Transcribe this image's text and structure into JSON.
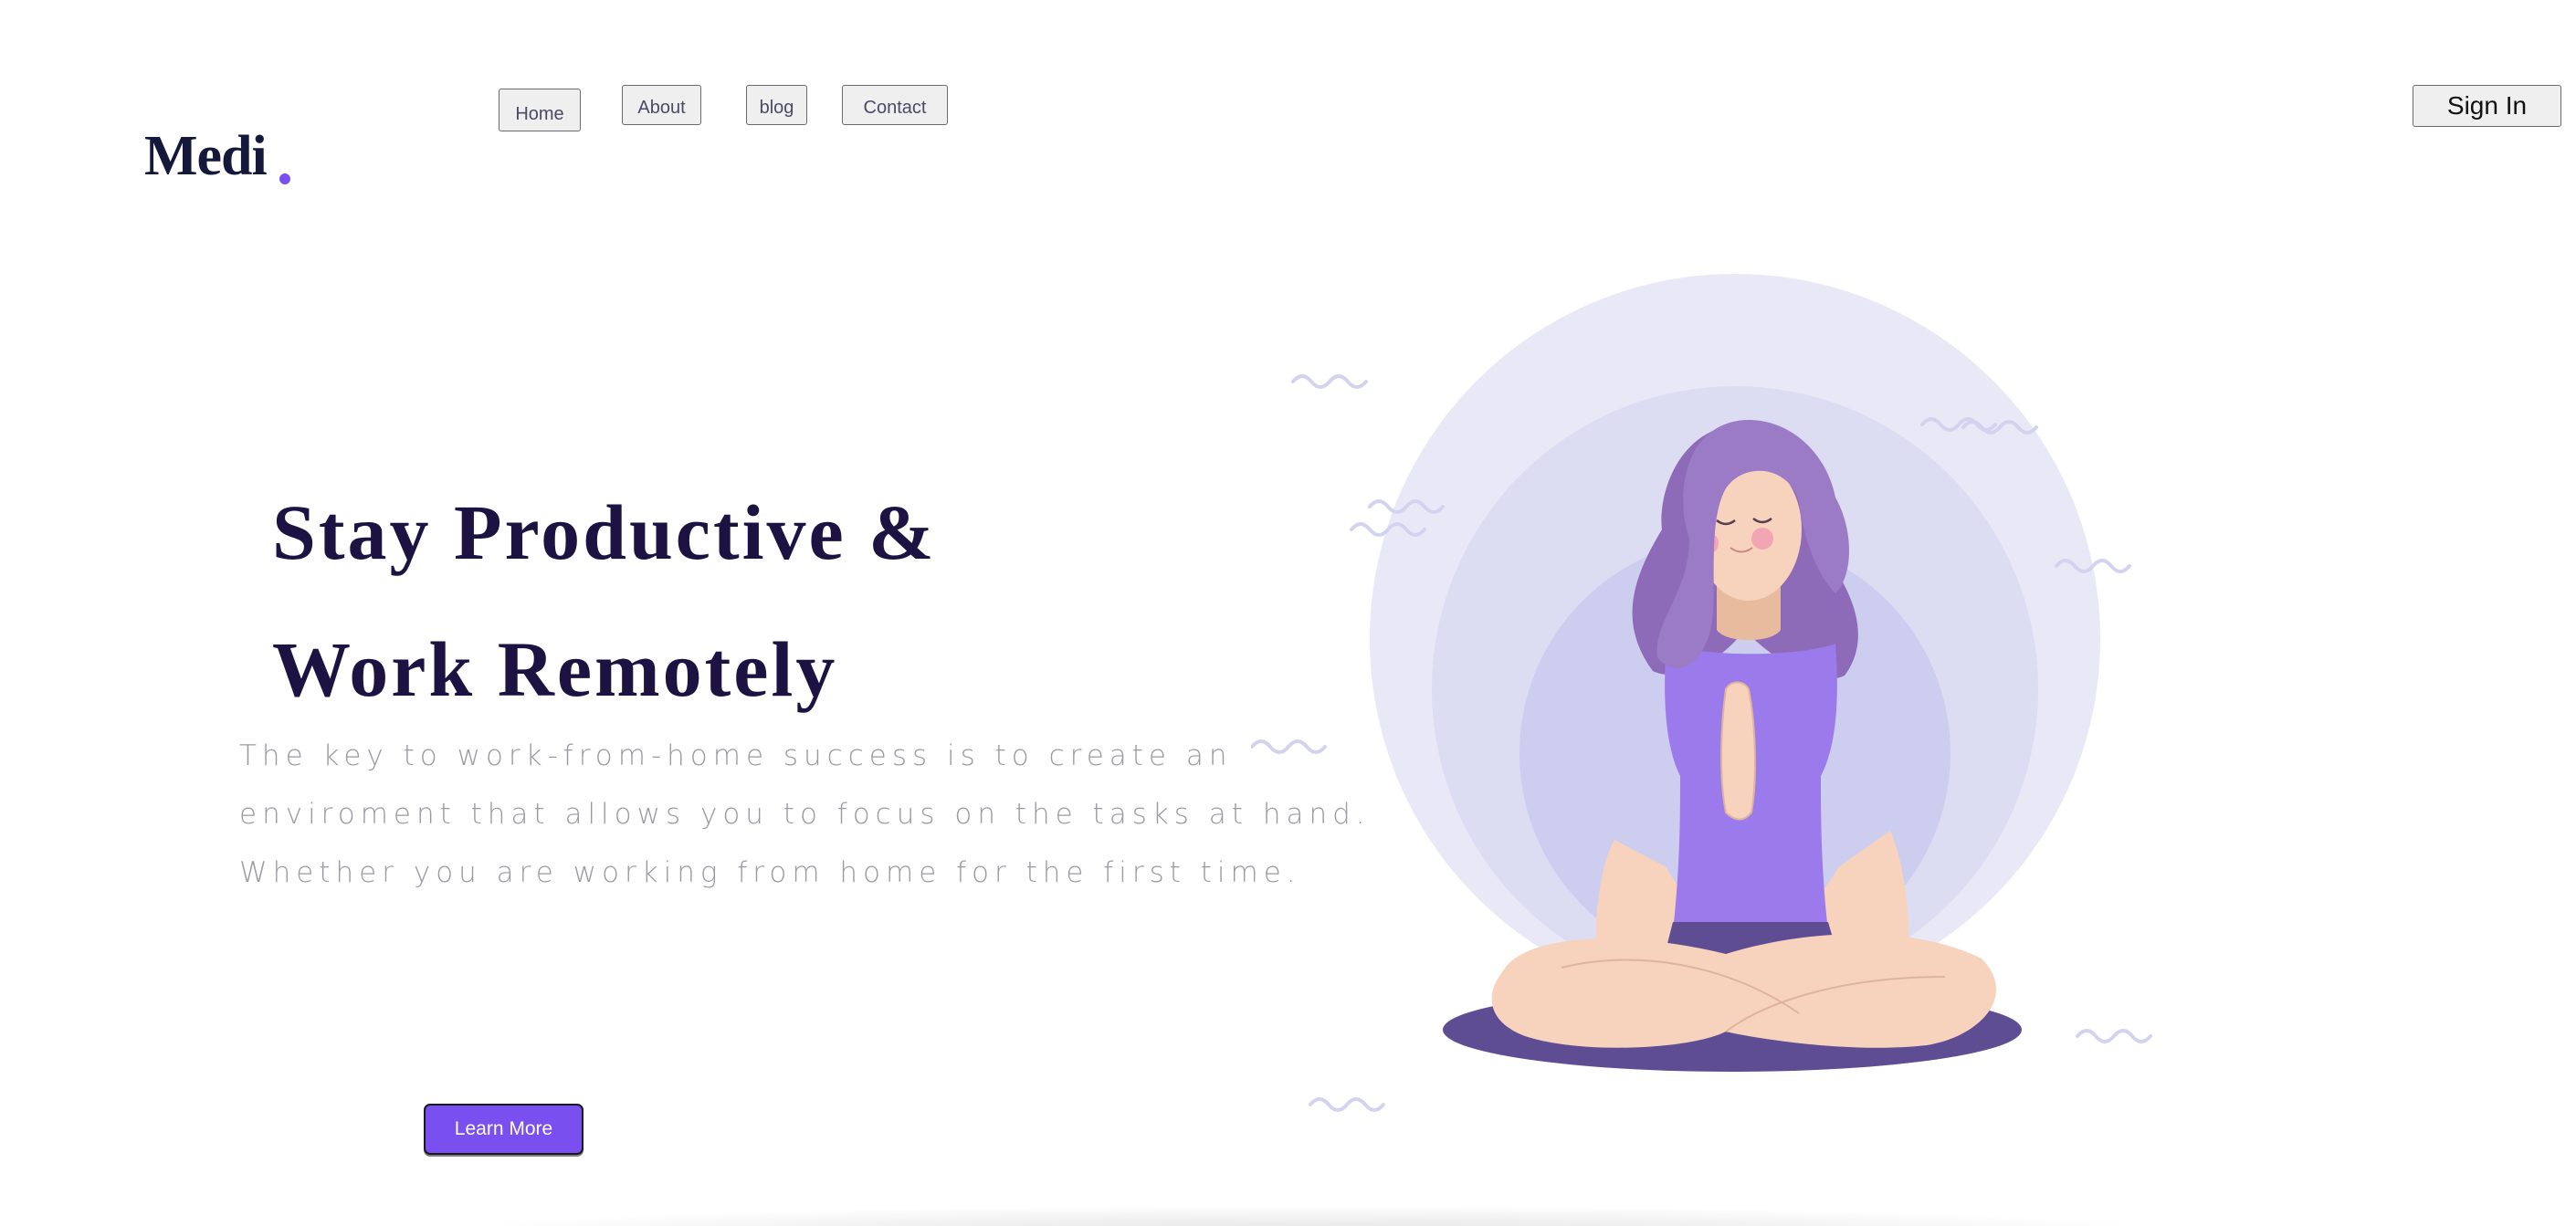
{
  "brand": {
    "name": "Medi",
    "accent_color": "#7a4ff0"
  },
  "nav": {
    "items": [
      {
        "label": "Home"
      },
      {
        "label": "About"
      },
      {
        "label": "blog"
      },
      {
        "label": "Contact"
      }
    ],
    "signin_label": "Sign In"
  },
  "hero": {
    "title_line_1": "Stay Productive &",
    "title_line_2": "Work Remotely",
    "description_lines": [
      "The key to work-from-home success is to create an",
      "enviroment that allows you to focus on the tasks at hand.",
      "Whether you are working from home for the first time."
    ],
    "cta_label": "Learn More"
  },
  "illustration": {
    "subject": "woman-meditating-illustration",
    "colors": {
      "outer_circle": "#e8e8f7",
      "middle_circle": "#dcdcf3",
      "inner_circle": "#cdcdef",
      "hair": "#8e6bb8",
      "top": "#9b7bec",
      "mat": "#5f4d94",
      "skin": "#f7d3be"
    }
  }
}
